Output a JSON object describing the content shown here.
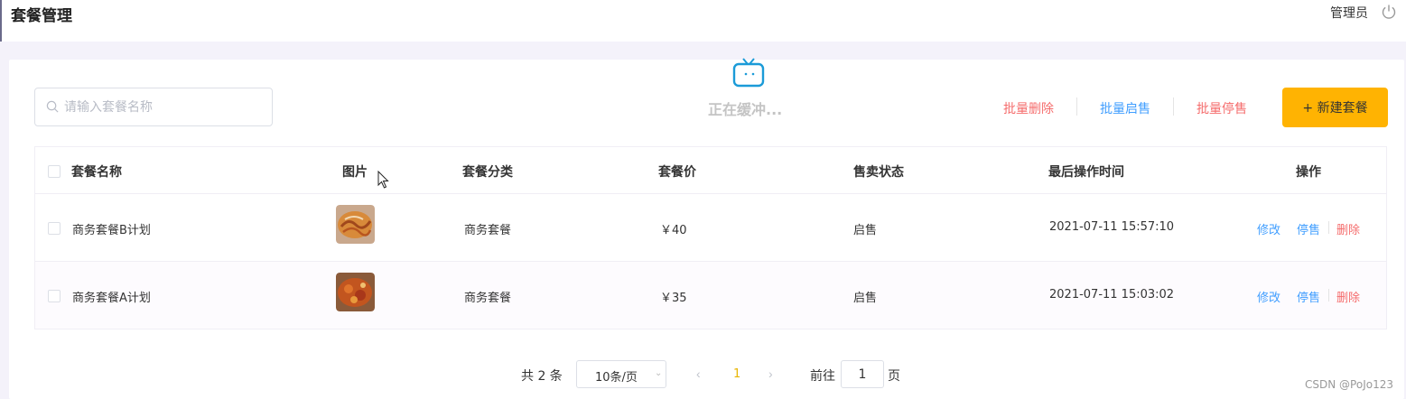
{
  "header": {
    "title": "套餐管理",
    "admin": "管理员"
  },
  "toolbar": {
    "search_placeholder": "请输入套餐名称",
    "buffering": "正在缓冲...",
    "batch_delete": "批量删除",
    "batch_enable": "批量启售",
    "batch_disable": "批量停售",
    "new_button": "+ 新建套餐"
  },
  "table": {
    "headers": [
      "套餐名称",
      "图片",
      "套餐分类",
      "套餐价",
      "售卖状态",
      "最后操作时间",
      "操作"
    ],
    "rows": [
      {
        "name": "商务套餐B计划",
        "category": "商务套餐",
        "price": "￥40",
        "status": "启售",
        "updated": "2021-07-11 15:57:10",
        "edit": "修改",
        "toggle": "停售",
        "delete": "删除"
      },
      {
        "name": "商务套餐A计划",
        "category": "商务套餐",
        "price": "￥35",
        "status": "启售",
        "updated": "2021-07-11 15:03:02",
        "edit": "修改",
        "toggle": "停售",
        "delete": "删除"
      }
    ]
  },
  "pagination": {
    "total": "共 2 条",
    "page_size": "10条/页",
    "current": "1",
    "goto_label": "前往",
    "goto_value": "1",
    "goto_suffix": "页"
  },
  "watermark": "CSDN @PoJo123",
  "colors": {
    "accent": "#ffb302",
    "danger": "#f56c6c",
    "link": "#409eff"
  }
}
